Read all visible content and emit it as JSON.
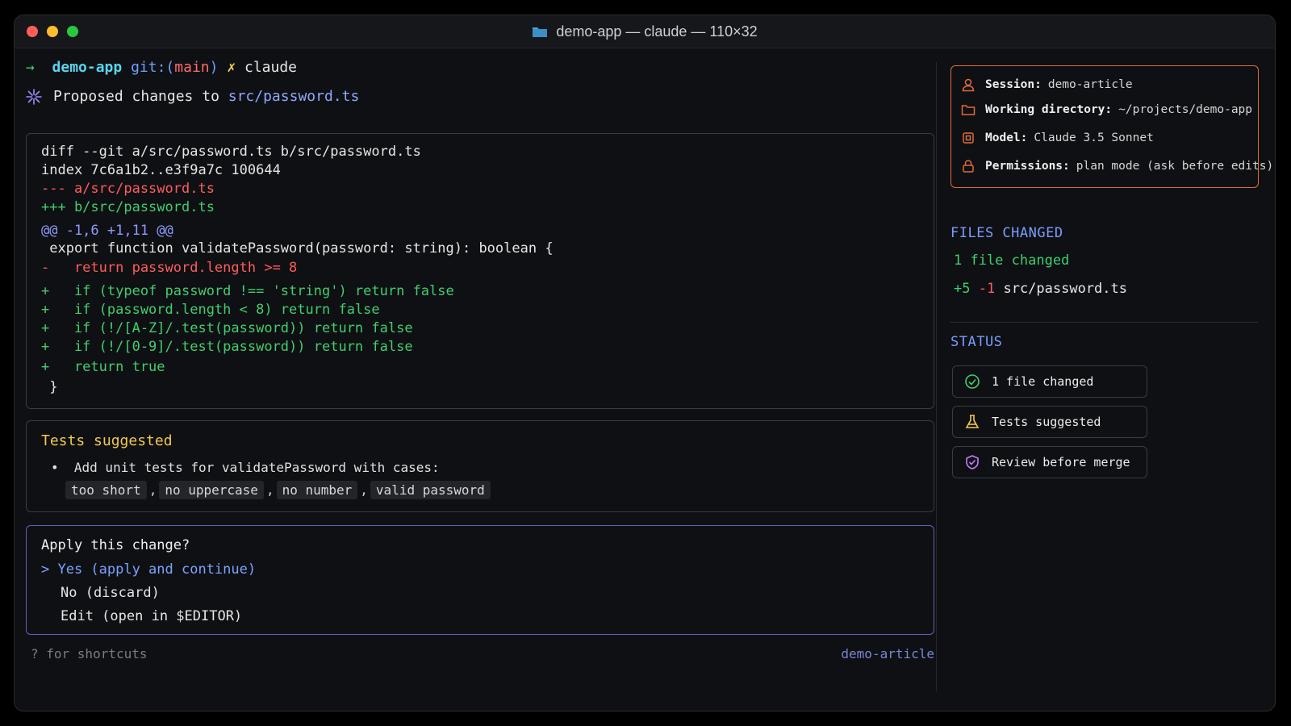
{
  "window": {
    "title": "demo-app — claude — 110×32"
  },
  "prompt": {
    "arrow": "→",
    "dir": "demo-app",
    "git_prefix": "git:(",
    "branch": "main",
    "git_suffix": ")",
    "xmark": "✗",
    "command": "claude"
  },
  "proposal": {
    "text": "Proposed changes to ",
    "path": "src/password.ts"
  },
  "diff": {
    "lines": [
      "diff --git a/src/password.ts b/src/password.ts",
      "index 7c6a1b2..e3f9a7c 100644",
      "--- a/src/password.ts",
      "+++ b/src/password.ts",
      "@@ -1,6 +1,11 @@",
      " export function validatePassword(password: string): boolean {",
      "-   return password.length >= 8",
      "+   if (typeof password !== 'string') return false",
      "+   if (password.length < 8) return false",
      "+   if (!/[A-Z]/.test(password)) return false",
      "+   if (!/[0-9]/.test(password)) return false",
      "+   return true",
      " }"
    ]
  },
  "tests": {
    "title": "Tests suggested",
    "bullet": "•  Add unit tests for validatePassword with cases:",
    "cases": [
      "too short",
      "no uppercase",
      "no number",
      "valid password"
    ],
    "separator": ","
  },
  "apply": {
    "question": "Apply this change?",
    "selected": "> Yes (apply and continue)",
    "option2": "No (discard)",
    "option3": "Edit (open in $EDITOR)"
  },
  "footer": {
    "shortcuts": "? for shortcuts",
    "session": "demo-article"
  },
  "info": {
    "session_key": "Session:",
    "session_val": "demo-article",
    "dir_key": "Working directory:",
    "dir_val": "~/projects/demo-app",
    "model_key": "Model:",
    "model_val": "Claude 3.5 Sonnet",
    "perm_key": "Permissions:",
    "perm_val": "plan mode (ask before edits)"
  },
  "files": {
    "title": "FILES CHANGED",
    "count": "1 file changed",
    "added": "+5",
    "removed": "-1",
    "file": "src/password.ts"
  },
  "status": {
    "title": "STATUS",
    "items": [
      "1 file changed",
      "Tests suggested",
      "Review before merge"
    ]
  },
  "colors": {
    "accent_orange": "#e06b3a",
    "accent_blue": "#7a9cff",
    "green": "#3fcf6e",
    "red": "#ff5c5c",
    "yellow": "#f2c94c"
  }
}
